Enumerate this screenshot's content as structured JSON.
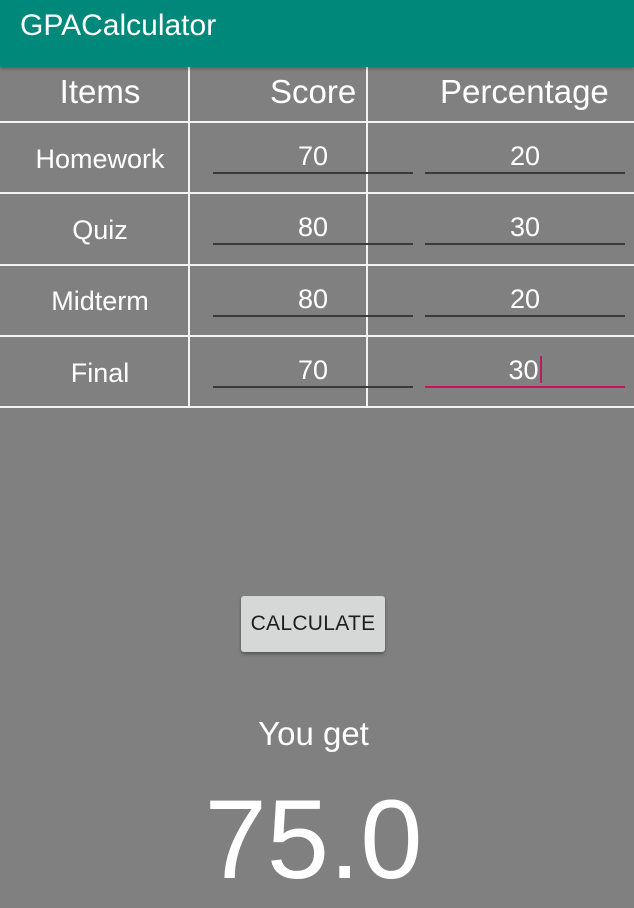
{
  "app": {
    "title": "GPACalculator",
    "accent_color": "#00897b",
    "background_color": "#808080",
    "focus_color": "#c2185b"
  },
  "table": {
    "headers": [
      "Items",
      "Score",
      "Percentage"
    ],
    "rows": [
      {
        "label": "Homework",
        "score": "70",
        "percentage": "20"
      },
      {
        "label": "Quiz",
        "score": "80",
        "percentage": "30"
      },
      {
        "label": "Midterm",
        "score": "80",
        "percentage": "20"
      },
      {
        "label": "Final",
        "score": "70",
        "percentage": "30"
      }
    ],
    "focused_field": "Final percentage"
  },
  "actions": {
    "calculate_label": "CALCULATE"
  },
  "result": {
    "label": "You get",
    "value": "75.0"
  }
}
